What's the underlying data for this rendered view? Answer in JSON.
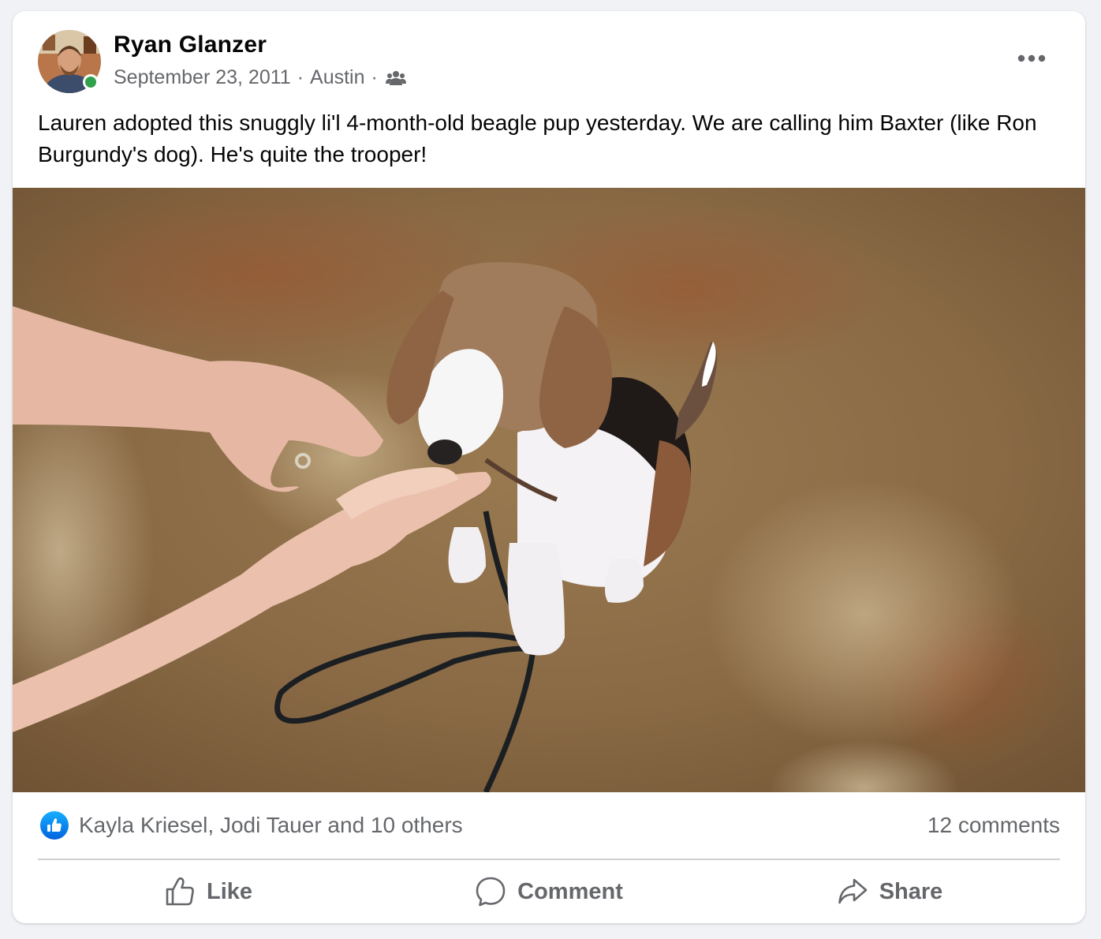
{
  "post": {
    "author": "Ryan Glanzer",
    "date": "September 23, 2011",
    "location": "Austin",
    "separator": "·",
    "audience_icon": "friends-icon",
    "menu_icon": "more-options-icon",
    "text": "Lauren adopted this snuggly li'l 4-month-old beagle pup yesterday. We are calling him Baxter (like Ron Burgundy's dog). He's quite the trooper!"
  },
  "reactions": {
    "icon": "like-reaction-icon",
    "summary": "Kayla Kriesel, Jodi Tauer and 10 others",
    "comments": "12 comments"
  },
  "actions": {
    "like": "Like",
    "comment": "Comment",
    "share": "Share"
  },
  "colors": {
    "page_bg": "#f0f2f5",
    "card_bg": "#ffffff",
    "secondary_text": "#65676b",
    "online_dot": "#31a24c",
    "like_blue": "#0866ff"
  }
}
